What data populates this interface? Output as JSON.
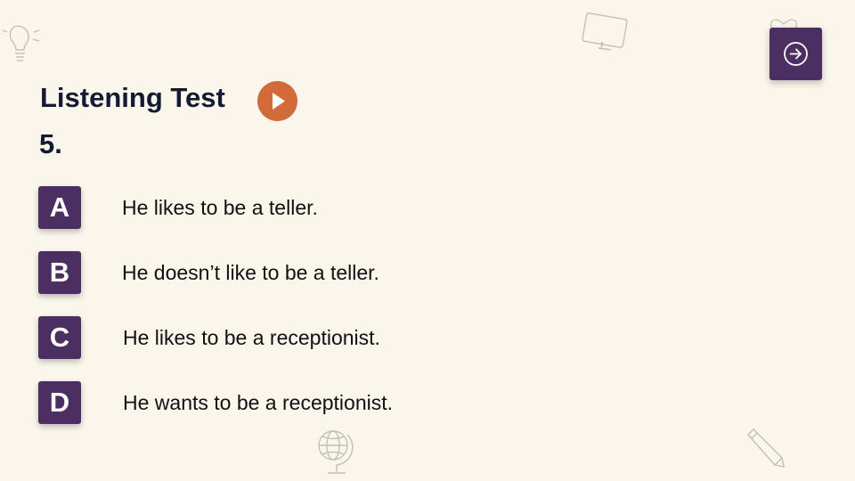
{
  "header": {
    "title": "Listening Test",
    "question_number": "5."
  },
  "options": [
    {
      "letter": "A",
      "text": "He likes to be a teller."
    },
    {
      "letter": "B",
      "text": "He doesn’t like to be a teller."
    },
    {
      "letter": "C",
      "text": "He likes to be a receptionist."
    },
    {
      "letter": "D",
      "text": "He wants to be a receptionist."
    }
  ],
  "icons": {
    "play": "play-icon",
    "next": "arrow-right-circle-icon",
    "decorations": [
      "lightbulb-icon",
      "monitor-icon",
      "heart-icon",
      "globe-icon",
      "pencil-icon"
    ]
  },
  "colors": {
    "background": "#faf6ec",
    "accent_purple": "#4b2f63",
    "play_orange": "#d36a3a",
    "title_text": "#141a33"
  }
}
